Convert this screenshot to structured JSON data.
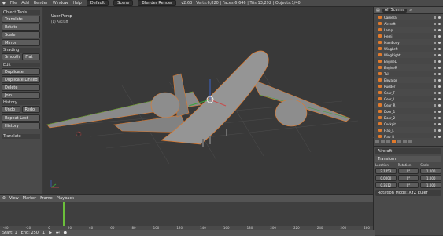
{
  "topbar": {
    "menus": [
      "File",
      "Add",
      "Render",
      "Window",
      "Help"
    ],
    "editor_type": "Default",
    "scene": "Scene",
    "engine": "Blender Render",
    "stats": "v2.63 | Verts:6,820 | Faces:6,646 | Tris:13,292 | Objects:1/40"
  },
  "toolshelf": {
    "sections": [
      {
        "header": "Object Tools",
        "items": [
          "Translate",
          "Rotate",
          "Scale",
          "Mirror"
        ]
      },
      {
        "header": "Shading",
        "items": [
          "Smooth",
          "Flat"
        ]
      },
      {
        "header": "Edit",
        "items": [
          "Duplicate",
          "Duplicate Linked",
          "Delete",
          "Join"
        ]
      },
      {
        "header": "History",
        "items": [
          "Undo",
          "Redo",
          "Repeat Last",
          "History"
        ]
      }
    ],
    "bottom_label": "Translate"
  },
  "viewport": {
    "label": "User Persp",
    "sub_label": "(1) Aircraft",
    "colors": {
      "plane": "#8f8f8f",
      "plane_edge": "#e07a2c",
      "ground": "#505050",
      "axis_x": "#c84b4b",
      "axis_y": "#3aa63a",
      "axis_z": "#3b62c7"
    }
  },
  "outliner": {
    "view": "All Scenes",
    "items": [
      "Camera",
      "Aircraft",
      "Lamp",
      "Hemi",
      "MainBody",
      "WingLeft",
      "WingRight",
      "EngineL",
      "EngineR",
      "Tail",
      "Elevator",
      "Rudder",
      "Gear_F",
      "Gear_L",
      "Gear_R",
      "Door_1",
      "Door_2",
      "Cockpit",
      "Flap_L",
      "Flap_R"
    ]
  },
  "properties": {
    "object_name": "Aircraft",
    "section": "Transform",
    "columns": [
      {
        "label": "Location",
        "values": [
          "2.1453",
          "0.0000",
          "0.3512"
        ]
      },
      {
        "label": "Rotation",
        "values": [
          "0°",
          "0°",
          "0°"
        ]
      },
      {
        "label": "Scale",
        "values": [
          "1.000",
          "1.000",
          "1.000"
        ]
      }
    ],
    "footer": "Rotation Mode: XYZ Euler"
  },
  "timeline": {
    "menus": [
      "View",
      "Marker",
      "Frame",
      "Playback"
    ],
    "ticks": [
      "-40",
      "-20",
      "0",
      "20",
      "40",
      "60",
      "80",
      "100",
      "120",
      "140",
      "160",
      "180",
      "200",
      "220",
      "240",
      "260",
      "280"
    ],
    "start": "Start: 1",
    "end": "End: 250",
    "current": "1"
  }
}
